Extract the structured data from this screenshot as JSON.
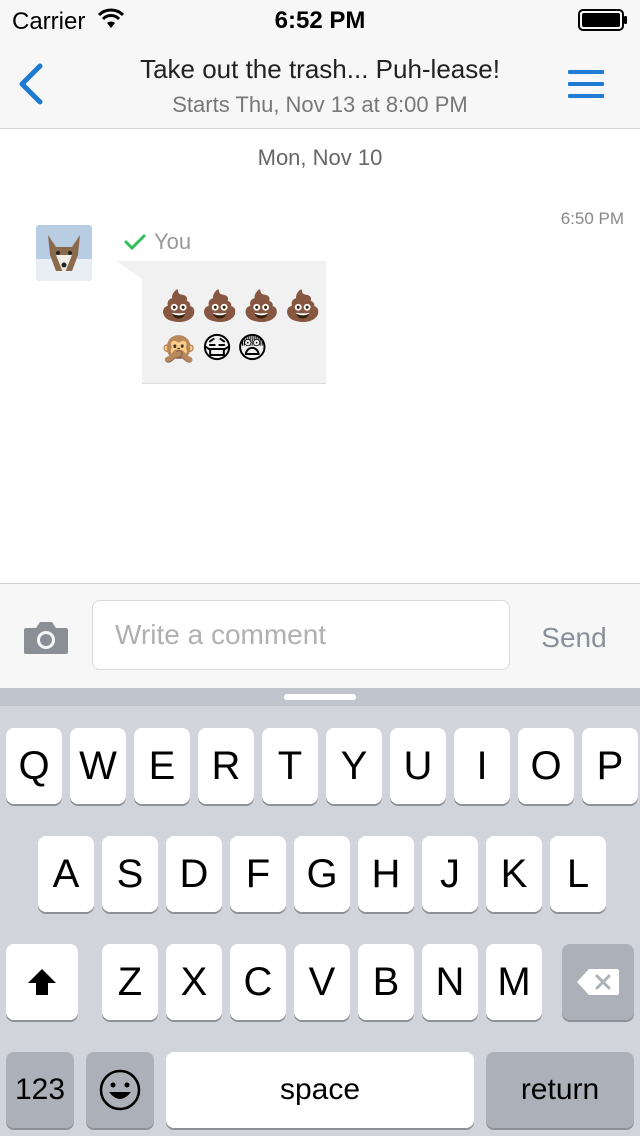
{
  "status_bar": {
    "carrier": "Carrier",
    "time": "6:52 PM"
  },
  "nav": {
    "title": "Take out the trash... Puh-lease!",
    "subtitle": "Starts Thu, Nov 13 at 8:00 PM"
  },
  "chat": {
    "date_header": "Mon, Nov 10",
    "messages": [
      {
        "time": "6:50 PM",
        "sender": "You",
        "lines": [
          "💩💩💩💩",
          "🙊😷😨"
        ]
      }
    ]
  },
  "input": {
    "placeholder": "Write a comment",
    "send_label": "Send"
  },
  "keyboard": {
    "row1": [
      "Q",
      "W",
      "E",
      "R",
      "T",
      "Y",
      "U",
      "I",
      "O",
      "P"
    ],
    "row2": [
      "A",
      "S",
      "D",
      "F",
      "G",
      "H",
      "J",
      "K",
      "L"
    ],
    "row3": [
      "Z",
      "X",
      "C",
      "V",
      "B",
      "N",
      "M"
    ],
    "numbers_label": "123",
    "space_label": "space",
    "return_label": "return"
  },
  "colors": {
    "accent": "#1f7ad1",
    "check": "#2fbf5b"
  }
}
